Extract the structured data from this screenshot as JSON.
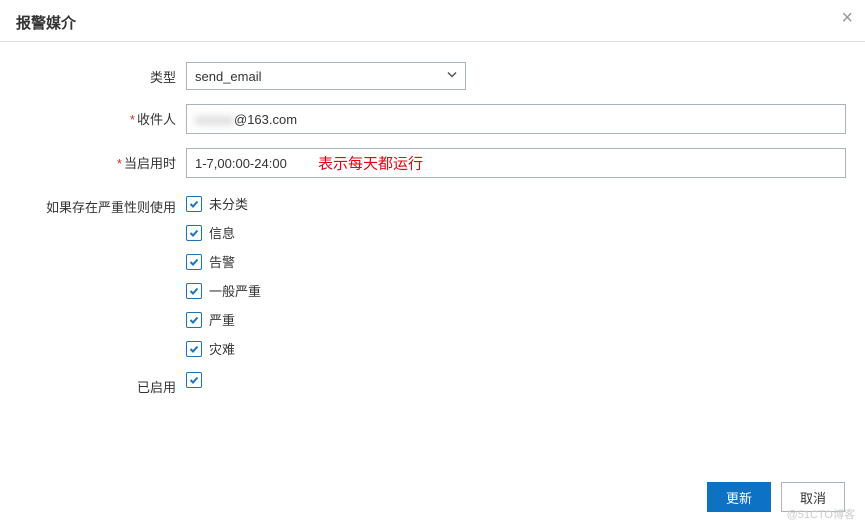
{
  "dialog": {
    "title": "报警媒介",
    "close_label": "×"
  },
  "form": {
    "type": {
      "label": "类型",
      "value": "send_email"
    },
    "recipient": {
      "label": "收件人",
      "required": true,
      "value_prefix": "xxxxxx",
      "value_suffix": "@163.com"
    },
    "when_enabled": {
      "label": "当启用时",
      "required": true,
      "value": "1-7,00:00-24:00",
      "annotation": "表示每天都运行"
    },
    "severity": {
      "label": "如果存在严重性则使用",
      "options": [
        {
          "label": "未分类",
          "checked": true
        },
        {
          "label": "信息",
          "checked": true
        },
        {
          "label": "告警",
          "checked": true
        },
        {
          "label": "一般严重",
          "checked": true
        },
        {
          "label": "严重",
          "checked": true
        },
        {
          "label": "灾难",
          "checked": true
        }
      ]
    },
    "enabled": {
      "label": "已启用",
      "checked": true
    }
  },
  "footer": {
    "update": "更新",
    "cancel": "取消"
  },
  "watermark": "@51CTO博客"
}
